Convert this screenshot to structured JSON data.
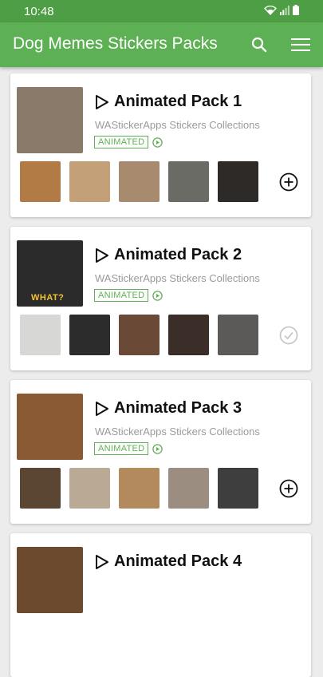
{
  "status_bar": {
    "time": "10:48"
  },
  "app_bar": {
    "title": "Dog Memes Stickers Packs"
  },
  "packs": [
    {
      "title": "Animated Pack 1",
      "publisher": "WAStickerApps Stickers Collections",
      "badge": "ANIMATED",
      "added": false,
      "thumb_caption": "",
      "thumb_color": "#8a7a6a",
      "sticker_colors": [
        "#b27b46",
        "#c3a078",
        "#a88a6e",
        "#6b6b65",
        "#2d2a28"
      ]
    },
    {
      "title": "Animated Pack 2",
      "publisher": "WAStickerApps Stickers Collections",
      "badge": "ANIMATED",
      "added": true,
      "thumb_caption": "WHAT?",
      "thumb_color": "#2b2b2b",
      "sticker_colors": [
        "#d7d7d5",
        "#2c2c2c",
        "#6a4a36",
        "#3b2e28",
        "#5c5a58"
      ]
    },
    {
      "title": "Animated Pack 3",
      "publisher": "WAStickerApps Stickers Collections",
      "badge": "ANIMATED",
      "added": false,
      "thumb_caption": "",
      "thumb_color": "#8a5a34",
      "sticker_colors": [
        "#5a4632",
        "#b9a995",
        "#b38a5e",
        "#9b8e80",
        "#3e3e3e"
      ]
    },
    {
      "title": "Animated Pack 4",
      "publisher": "",
      "badge": "",
      "added": false,
      "thumb_caption": "",
      "thumb_color": "#6b4a2e",
      "sticker_colors": []
    }
  ]
}
